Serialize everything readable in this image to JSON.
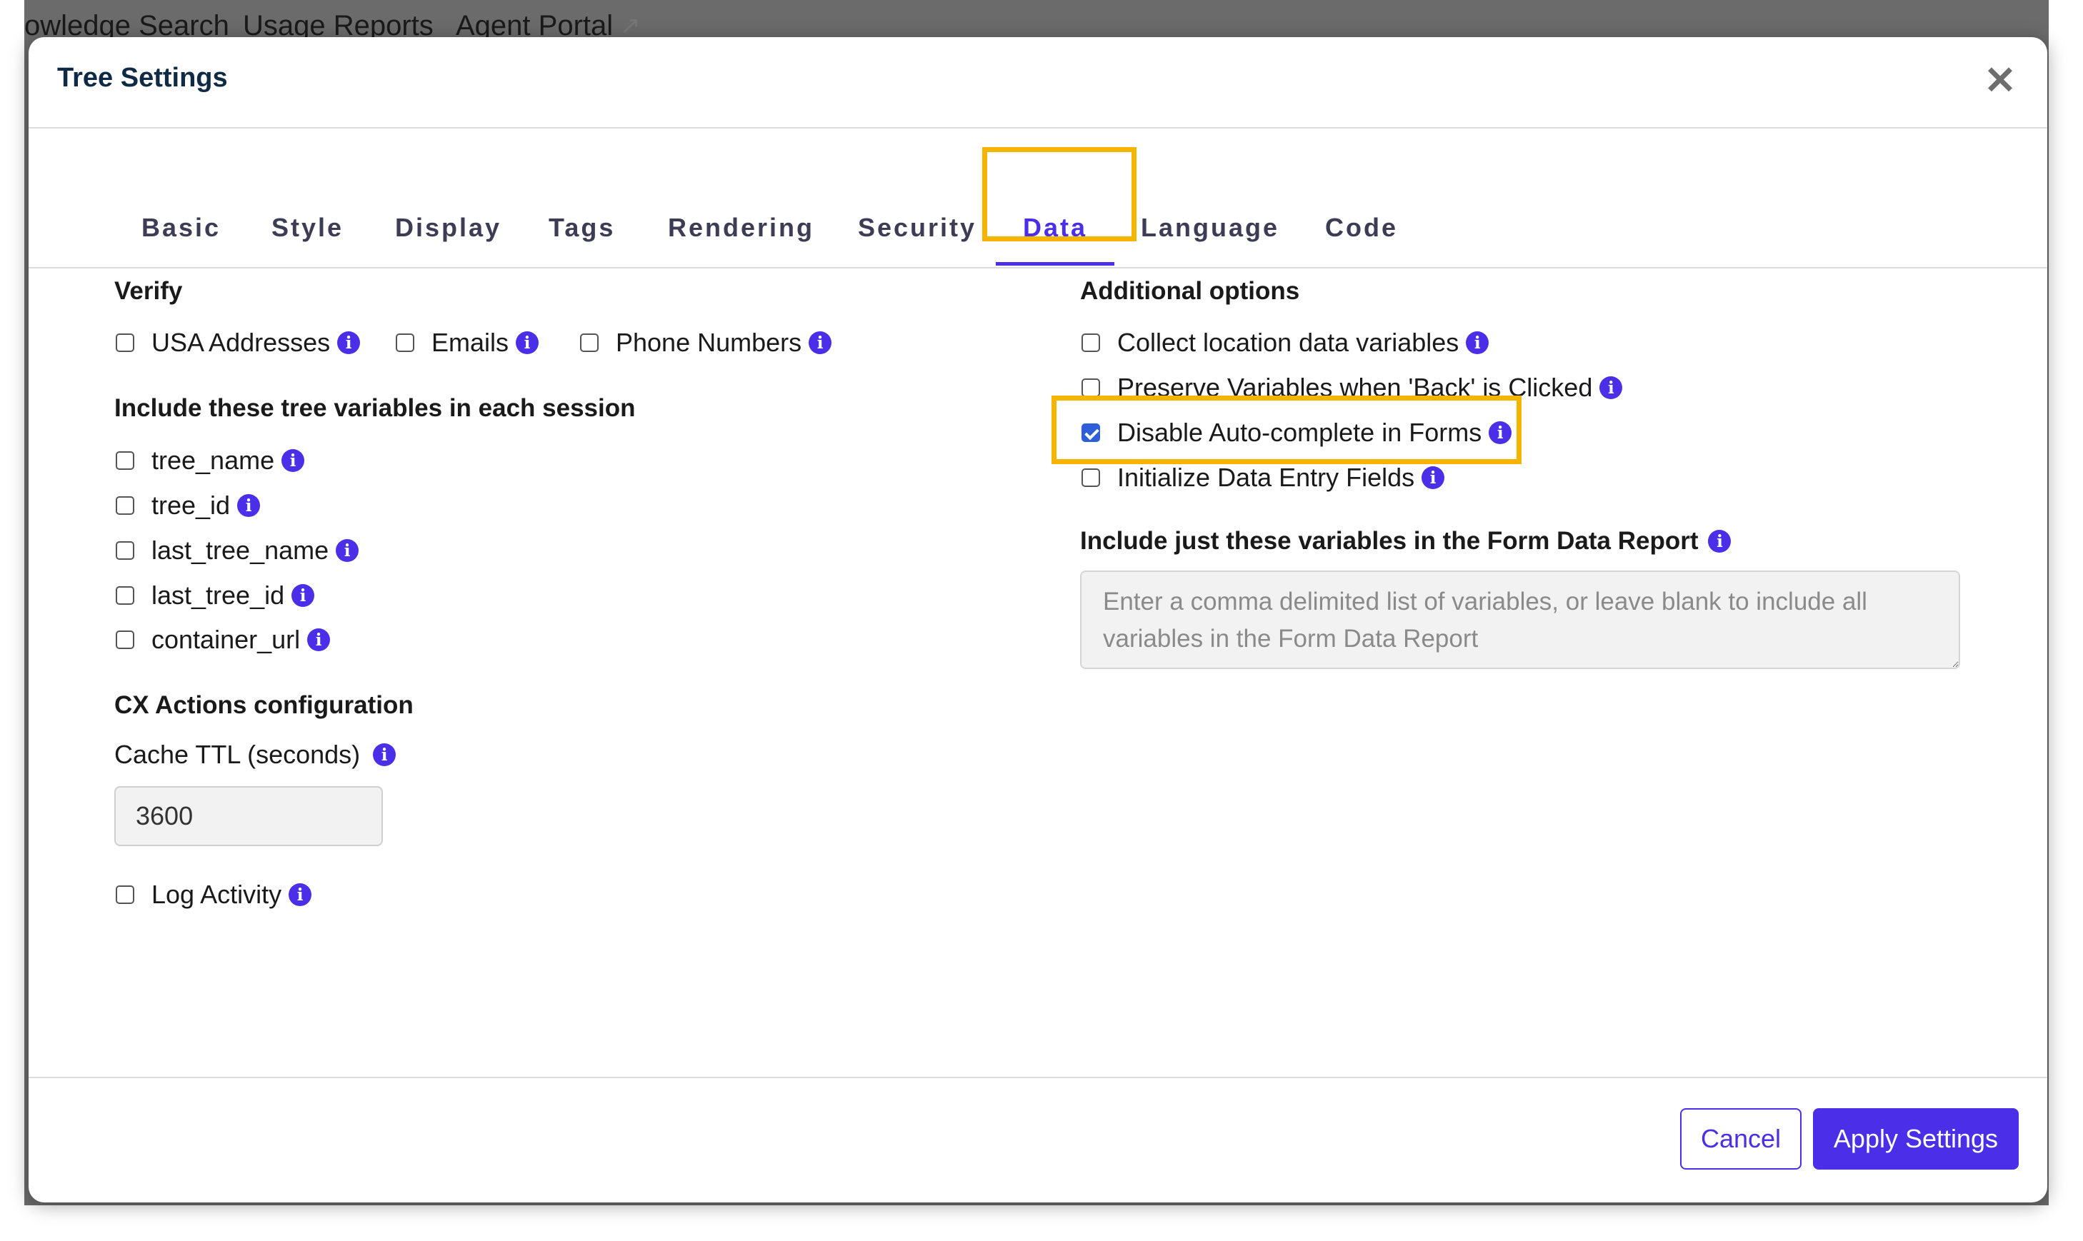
{
  "background_nav": {
    "items": [
      "owledge Search",
      "Usage Reports",
      "Agent Portal"
    ]
  },
  "modal": {
    "title": "Tree Settings",
    "close_icon": "close-icon",
    "tabs": [
      "Basic",
      "Style",
      "Display",
      "Tags",
      "Rendering",
      "Security",
      "Data",
      "Language",
      "Code"
    ],
    "active_tab": "Data"
  },
  "verify": {
    "heading": "Verify",
    "options": [
      {
        "label": "USA Addresses",
        "checked": false
      },
      {
        "label": "Emails",
        "checked": false
      },
      {
        "label": "Phone Numbers",
        "checked": false
      }
    ]
  },
  "tree_variables": {
    "heading": "Include these tree variables in each session",
    "options": [
      {
        "label": "tree_name",
        "checked": false
      },
      {
        "label": "tree_id",
        "checked": false
      },
      {
        "label": "last_tree_name",
        "checked": false
      },
      {
        "label": "last_tree_id",
        "checked": false
      },
      {
        "label": "container_url",
        "checked": false
      }
    ]
  },
  "cx_actions": {
    "heading": "CX Actions configuration",
    "cache_ttl_label": "Cache TTL (seconds)",
    "cache_ttl_value": "3600",
    "log_activity": {
      "label": "Log Activity",
      "checked": false
    }
  },
  "additional_options": {
    "heading": "Additional options",
    "options": [
      {
        "label": "Collect location data variables",
        "checked": false
      },
      {
        "label": "Preserve Variables when 'Back' is Clicked",
        "checked": false
      },
      {
        "label": "Disable Auto-complete in Forms",
        "checked": true
      },
      {
        "label": "Initialize Data Entry Fields",
        "checked": false
      }
    ]
  },
  "form_data_report": {
    "label": "Include just these variables in the Form Data Report",
    "placeholder": "Enter a comma delimited list of variables, or leave blank to include all variables in the Form Data Report"
  },
  "footer": {
    "cancel_label": "Cancel",
    "apply_label": "Apply Settings"
  },
  "colors": {
    "accent": "#4b2ee8",
    "highlight": "#f4b400",
    "title": "#0f2a44"
  }
}
